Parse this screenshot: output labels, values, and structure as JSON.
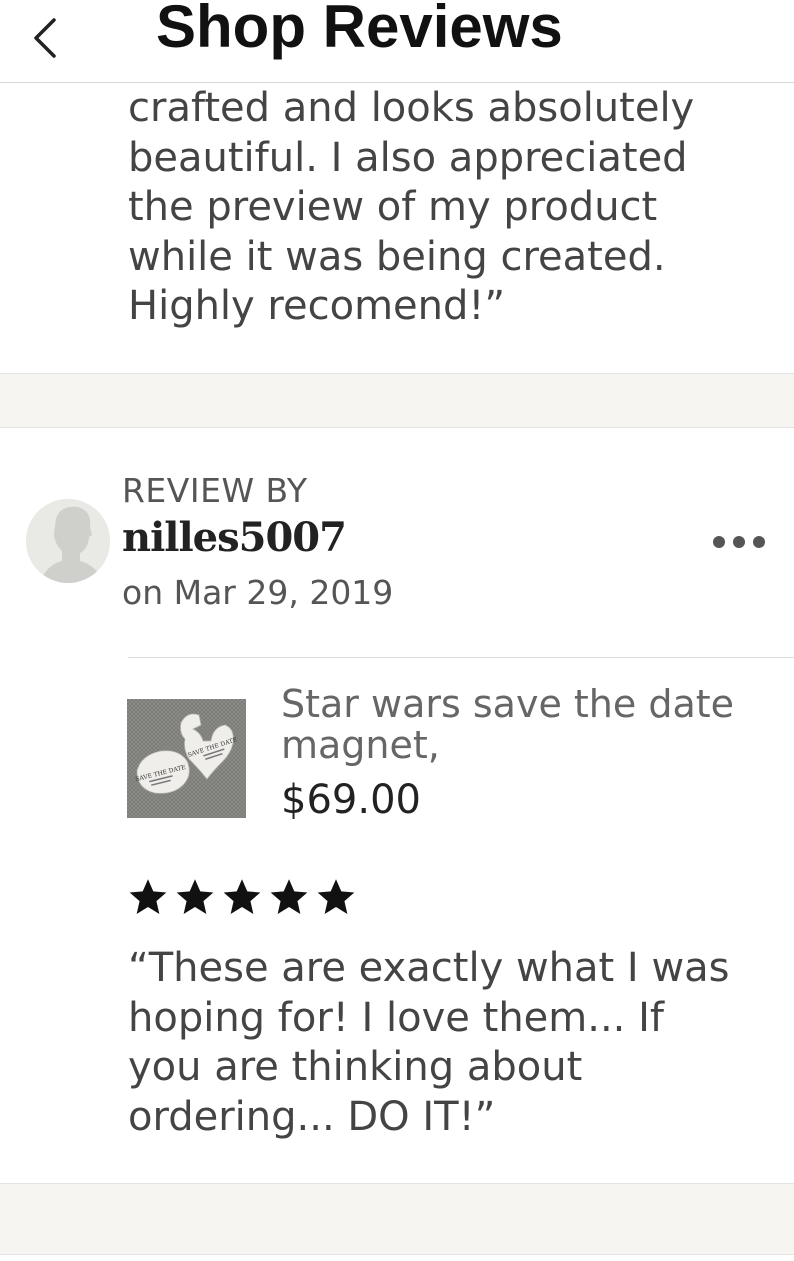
{
  "header": {
    "title": "Shop Reviews",
    "back_icon": "chevron-left-icon"
  },
  "previous_review": {
    "text_partial": "crafted and looks absolutely\nbeautiful. I also appreciated\nthe preview of my product\nwhile it was being created.\nHighly recomend!”"
  },
  "review": {
    "label": "REVIEW BY",
    "reviewer": "nilles5007",
    "date": "on Mar 29, 2019",
    "avatar_icon": "default-avatar-icon",
    "more_icon": "more-dots-icon",
    "product": {
      "title": "Star wars save the date magnet,",
      "price": "$69.00",
      "image_icon": "product-thumbnail"
    },
    "rating": 5,
    "rating_max": 5,
    "text": "“These are exactly what I was\nhoping for! I love them... If\nyou are thinking about\nordering... DO IT!”"
  },
  "colors": {
    "band": "#f6f5f2",
    "text": "#444444",
    "muted": "#555555",
    "star": "#111111"
  }
}
